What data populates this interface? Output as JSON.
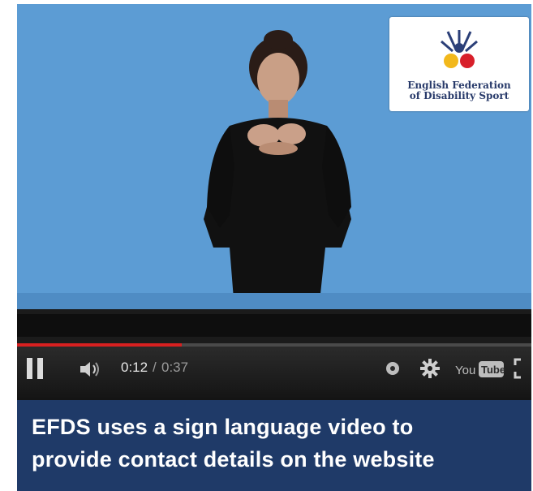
{
  "video": {
    "logo_text_line1": "English Federation",
    "logo_text_line2": "of Disability Sport",
    "progress_fraction": 0.32
  },
  "controls": {
    "time_current": "0:12",
    "time_separator": "/",
    "time_total": "0:37",
    "youtube_label": "YouTube"
  },
  "caption": {
    "line1": "EFDS uses a sign language video to",
    "line2": "provide contact details on the website"
  },
  "colors": {
    "video_background": "#5c9cd4",
    "caption_background": "#1f3a68",
    "progress_red": "#d82020"
  }
}
